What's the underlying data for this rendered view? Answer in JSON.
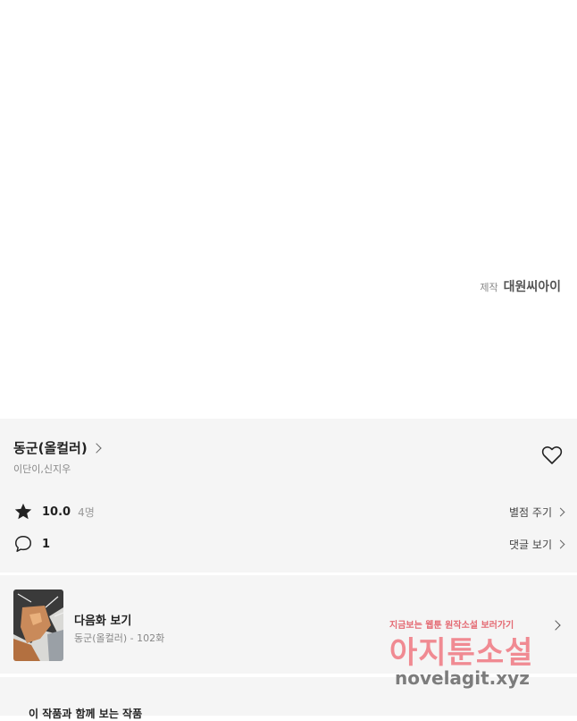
{
  "credit": {
    "label": "제작",
    "studio": "대원씨아이"
  },
  "work": {
    "title": "동군(올컬러)",
    "authors": "이단이,신지우"
  },
  "rating": {
    "score": "10.0",
    "count": "4명",
    "action": "별점 주기"
  },
  "comments": {
    "count": "1",
    "action": "댓글 보기"
  },
  "next_episode": {
    "label": "다음화 보기",
    "subtitle": "동군(올컬러) - 102화"
  },
  "recommend": {
    "title": "이 작품과 함께 보는 작품"
  },
  "watermark": {
    "tagline": "지금보는 웹툰 원작소설 보러가기",
    "brand": "아지툰소설",
    "url": "novelagit.xyz"
  },
  "colors": {
    "panel_bg": "#f5f5f5",
    "watermark_pink": "#f07f88"
  }
}
